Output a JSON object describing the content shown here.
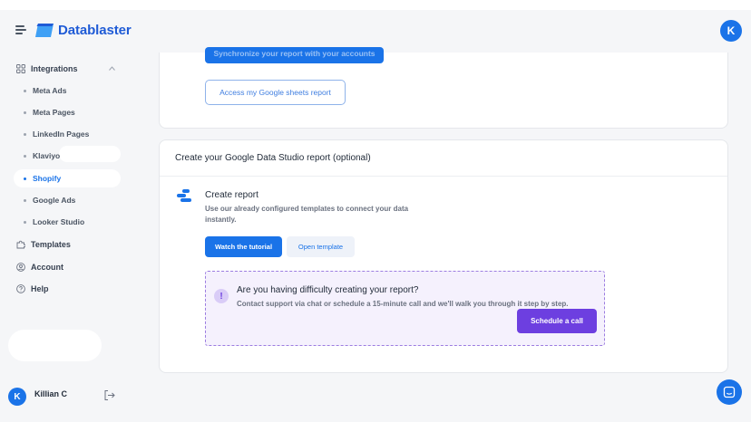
{
  "header": {
    "brand": "Datablaster",
    "user_initial": "K"
  },
  "sidebar": {
    "integrations_label": "Integrations",
    "items": [
      {
        "label": "Meta Ads"
      },
      {
        "label": "Meta Pages"
      },
      {
        "label": "LinkedIn Pages"
      },
      {
        "label": "Klaviyo"
      },
      {
        "label": "Shopify",
        "active": true
      },
      {
        "label": "Google Ads"
      },
      {
        "label": "Looker Studio"
      }
    ],
    "templates_label": "Templates",
    "account_label": "Account",
    "help_label": "Help",
    "user": {
      "initial": "K",
      "name": "Killian C"
    }
  },
  "card1": {
    "sync_button": "Synchronize your report with your accounts",
    "sheets_button": "Access my Google sheets report"
  },
  "card2": {
    "title": "Create your Google Data Studio report (optional)",
    "report_title": "Create report",
    "report_desc": "Use our already configured templates to connect your data instantly.",
    "tutorial_button": "Watch the tutorial",
    "template_button": "Open template",
    "help": {
      "icon": "!",
      "title": "Are you having difficulty creating your report?",
      "desc": "Contact support via chat or schedule a 15-minute call and we'll walk you through it step by step.",
      "call_button": "Schedule a call"
    }
  },
  "colors": {
    "primary": "#1a73e8",
    "purple": "#6d3fe0",
    "background": "#f5f6f8"
  }
}
